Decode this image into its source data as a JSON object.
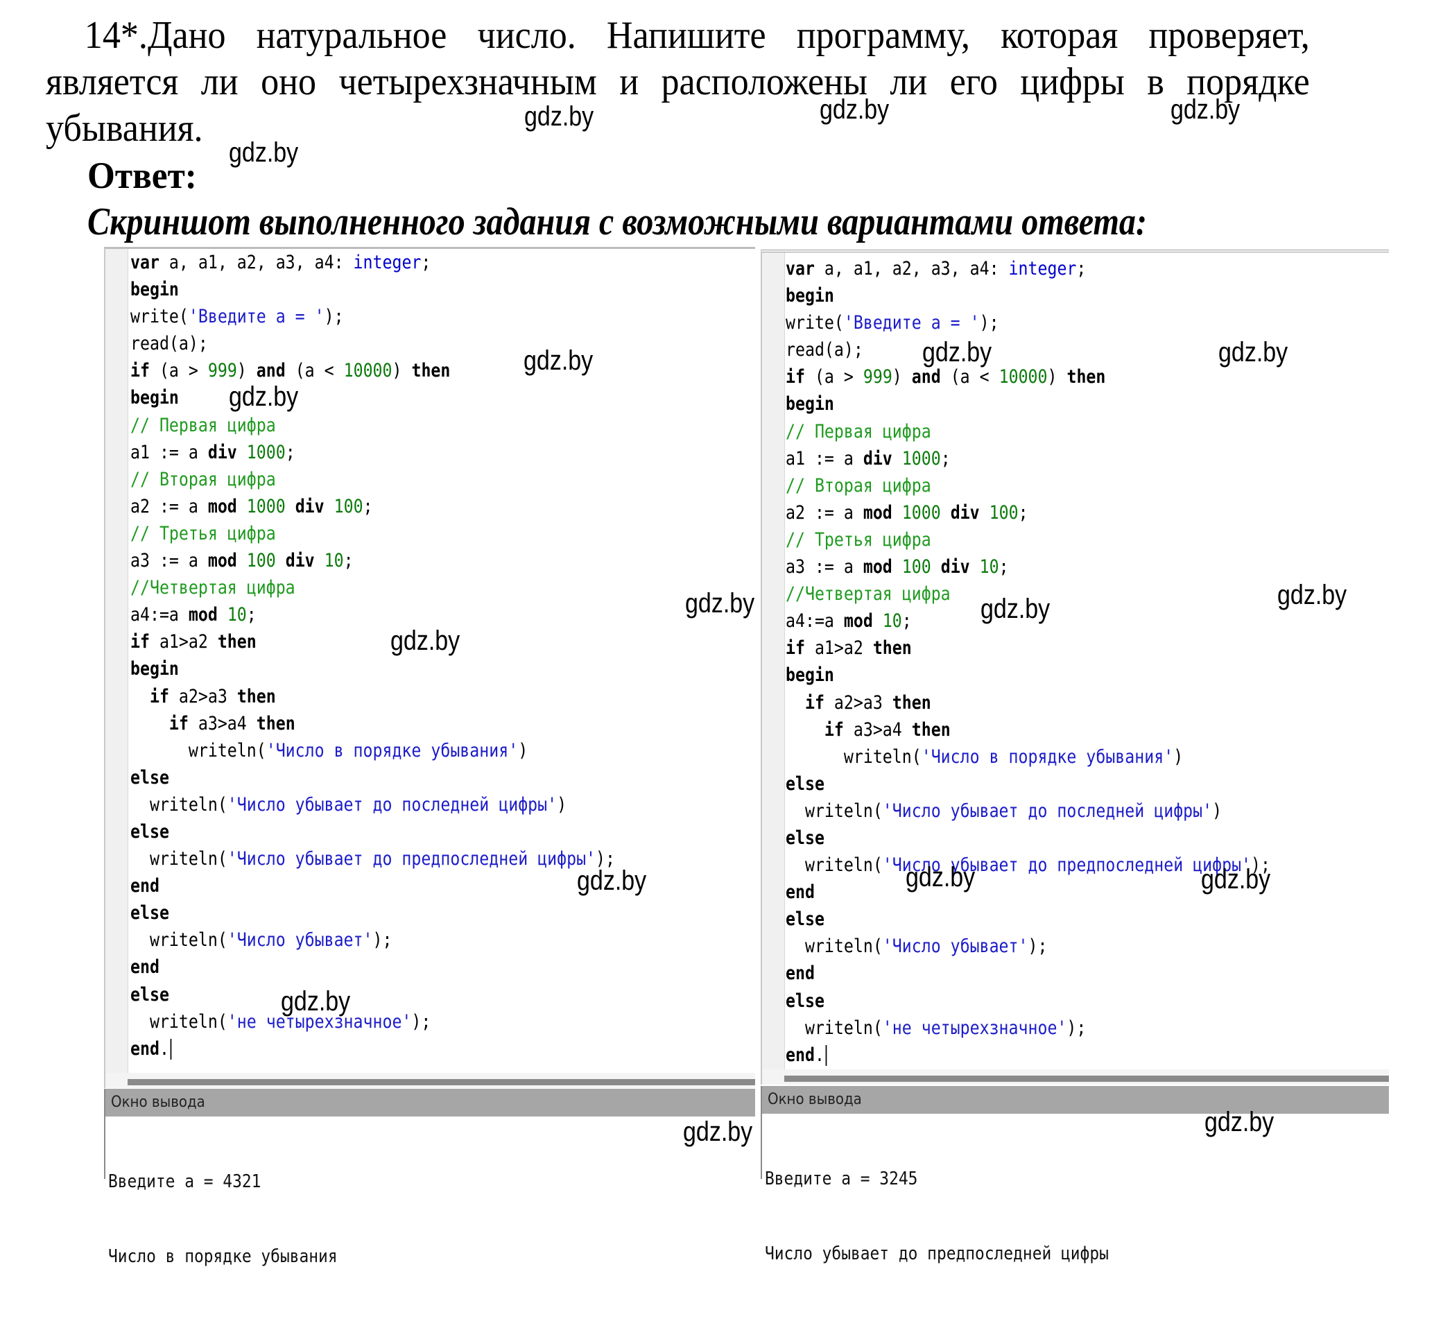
{
  "task": {
    "number": "14*.",
    "text": "Дано натуральное число. Напишите программу, которая проверяет, является ли оно четырехзначным и расположены ли его цифры в порядке убывания."
  },
  "answer_label": "Ответ:",
  "subheading": "Скриншот выполненного задания с возможными вариантами ответа:",
  "watermark": "gdz.by",
  "code": {
    "lines": [
      "var a, a1, a2, a3, a4: integer;",
      "begin",
      "write('Введите a = ');",
      "read(a);",
      "if (a > 999) and (a < 10000) then",
      "begin",
      "// Первая цифра",
      "a1 := a div 1000;",
      "// Вторая цифра",
      "a2 := a mod 1000 div 100;",
      "// Третья цифра",
      "a3 := a mod 100 div 10;",
      "//Четвертая цифра",
      "a4:=a mod 10;",
      "if a1>a2 then",
      "begin",
      "  if a2>a3 then",
      "    if a3>a4 then",
      "      writeln('Число в порядке убывания')",
      "else",
      "  writeln('Число убывает до последней цифры')",
      "else",
      "  writeln('Число убывает до предпоследней цифры');",
      "end",
      "else",
      "  writeln('Число убывает');",
      "end",
      "else",
      "  writeln('не четырехзначное');",
      "end."
    ]
  },
  "panels": [
    {
      "output_title": "Окно вывода",
      "output_lines": [
        "Введите a = 4321",
        "Число в порядке убывания"
      ]
    },
    {
      "output_title": "Окно вывода",
      "output_lines": [
        "Введите a = 3245",
        "Число убывает до предпоследней цифры"
      ]
    }
  ],
  "colors": {
    "keyword": "#000000",
    "type": "#0000cc",
    "string": "#1c1cc8",
    "number": "#0c7a0c",
    "comment": "#1f9a1f",
    "output_header": "#a6a6a6"
  }
}
